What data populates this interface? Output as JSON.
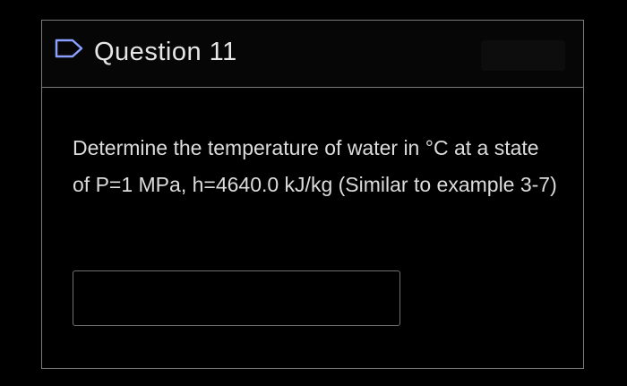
{
  "question": {
    "title": "Question 11",
    "flag_icon": "flag-outline-icon",
    "text": "Determine the temperature of water in °C  at a state of P=1 MPa, h=4640.0 kJ/kg (Similar to example 3-7)"
  },
  "answer": {
    "value": "",
    "placeholder": ""
  },
  "colors": {
    "background": "#000000",
    "border": "#7a7a7a",
    "text": "#dcdcdc"
  }
}
